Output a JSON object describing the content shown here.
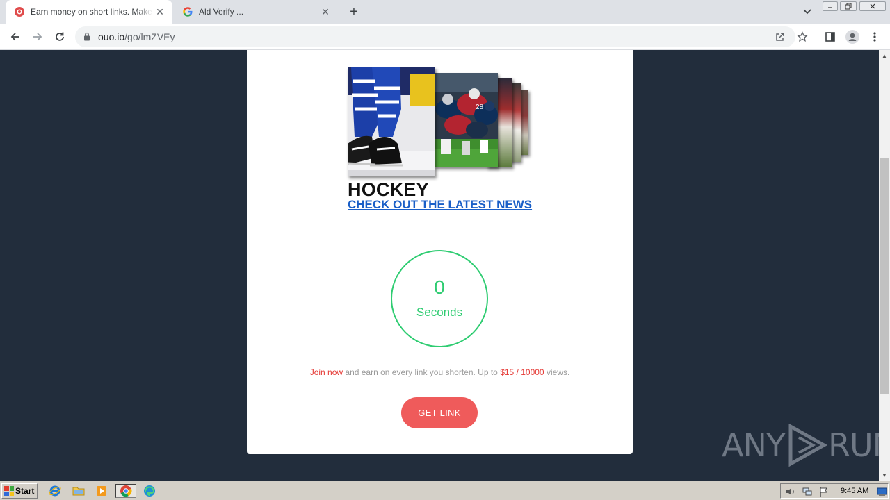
{
  "browser": {
    "tabs": [
      {
        "title": "Earn money on short links. Make sho",
        "active": true,
        "favicon": "ouo-favicon"
      },
      {
        "title": "Ald Verify ...",
        "active": false,
        "favicon": "google-favicon"
      }
    ],
    "close_glyph": "✕",
    "new_tab_glyph": "+",
    "url_host": "ouo.io",
    "url_path": "/go/lmZVEy"
  },
  "page": {
    "ad_title": "HOCKEY",
    "ad_link": "CHECK OUT THE LATEST NEWS",
    "timer_value": "0",
    "timer_label": "Seconds",
    "promo": {
      "join": "Join now",
      "middle": " and earn on every link you shorten. Up to ",
      "rate": "$15 / 10000",
      "end": " views."
    },
    "button_label": "GET LINK",
    "colors": {
      "accent_green": "#2ecc71",
      "button_red": "#ef5b5b",
      "link_blue": "#1a5fc7",
      "promo_red": "#e53935",
      "page_bg": "#222d3c"
    }
  },
  "watermark": {
    "left": "ANY",
    "right": "RUN"
  },
  "taskbar": {
    "start_label": "Start",
    "clock": "9:45 AM",
    "quick_launch": [
      "ie-icon",
      "folder-icon",
      "media-player-icon",
      "chrome-icon",
      "edge-icon"
    ]
  }
}
